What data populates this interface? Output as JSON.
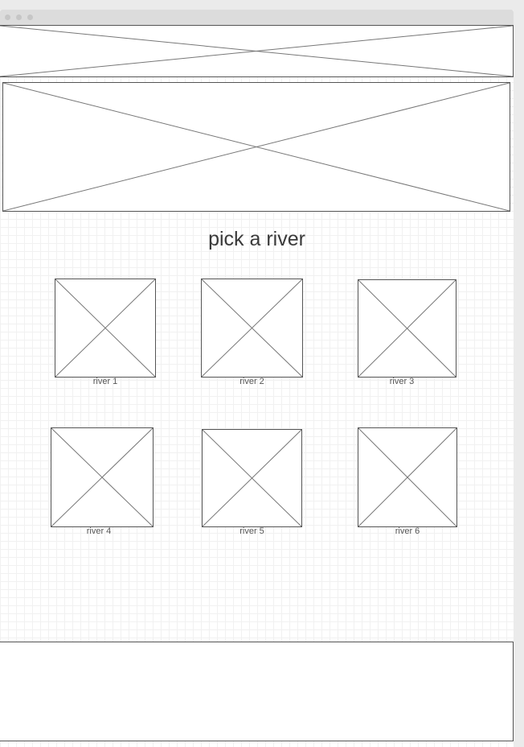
{
  "page": {
    "title": "pick a river"
  },
  "rivers": [
    {
      "label": "river 1"
    },
    {
      "label": "river 2"
    },
    {
      "label": "river 3"
    },
    {
      "label": "river 4"
    },
    {
      "label": "river 5"
    },
    {
      "label": "river 6"
    }
  ],
  "icons": {
    "placeholder": "image-placeholder-icon"
  }
}
